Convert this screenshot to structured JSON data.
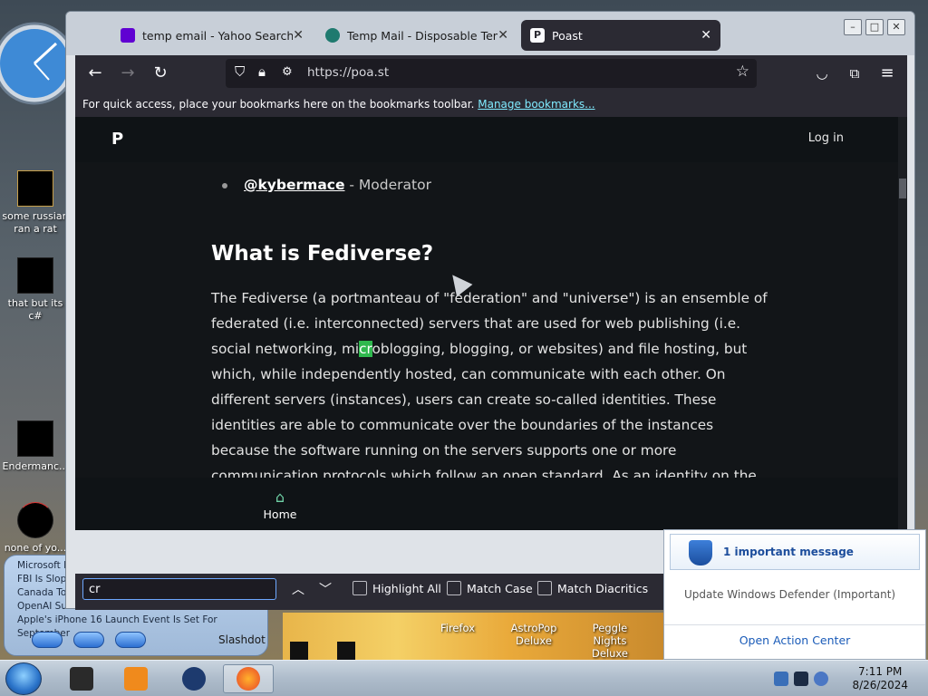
{
  "desktop": {
    "icons": [
      {
        "label": "some russian\nran a rat"
      },
      {
        "label": "that but its c#"
      },
      {
        "label": "Endermanc..."
      },
      {
        "label": "none of yo..."
      }
    ],
    "news": {
      "lines": [
        "Microsoft L...",
        "FBI Is Slop...",
        "Canada To...",
        "OpenAI Su...",
        "Apple's iPhone 16 Launch Event Is Set For September"
      ],
      "source": "Slashdot"
    },
    "shortcuts": [
      "Firefox",
      "AstroPop Deluxe",
      "Peggle Nights Deluxe"
    ]
  },
  "browser": {
    "tabs": [
      {
        "label": "temp email - Yahoo Search Res",
        "favicon_color": "#6001d2"
      },
      {
        "label": "Temp Mail - Disposable Tempor",
        "favicon_color": "#1f7a6f"
      },
      {
        "label": "Poast",
        "favicon_color": "#2b2a33"
      }
    ],
    "url": "https://poa.st",
    "bookmarks_hint": "For quick access, place your bookmarks here on the bookmarks toolbar.",
    "bookmarks_link": "Manage bookmarks..."
  },
  "site": {
    "login": "Log in",
    "moderator_handle": "@kybermace",
    "moderator_role": " - Moderator",
    "heading": "What is Fediverse?",
    "para_before": "The Fediverse (a portmanteau of \"federation\" and \"universe\") is an ensemble of federated (i.e. interconnected) servers that are used for web publishing (i.e. social networking, mi",
    "para_highlight": "cr",
    "para_after": "oblogging, blogging, or websites) and file hosting, but which, while independently hosted, can communicate with each other. On different servers (instances), users can create so-called identities. These identities are able to communicate over the boundaries of the instances because the software running on the servers supports one or more communication protocols which follow an open standard. As an identity on the fediverse, users are able to post text and other media, or to follow posts by",
    "home_label": "Home"
  },
  "findbar": {
    "value": "cr",
    "options": [
      "Highlight All",
      "Match Case",
      "Match Diacritics"
    ]
  },
  "notification": {
    "title": "1 important message",
    "message": "Update Windows Defender (Important)",
    "action": "Open Action Center"
  },
  "taskbar": {
    "time": "7:11 PM",
    "date": "8/26/2024"
  }
}
